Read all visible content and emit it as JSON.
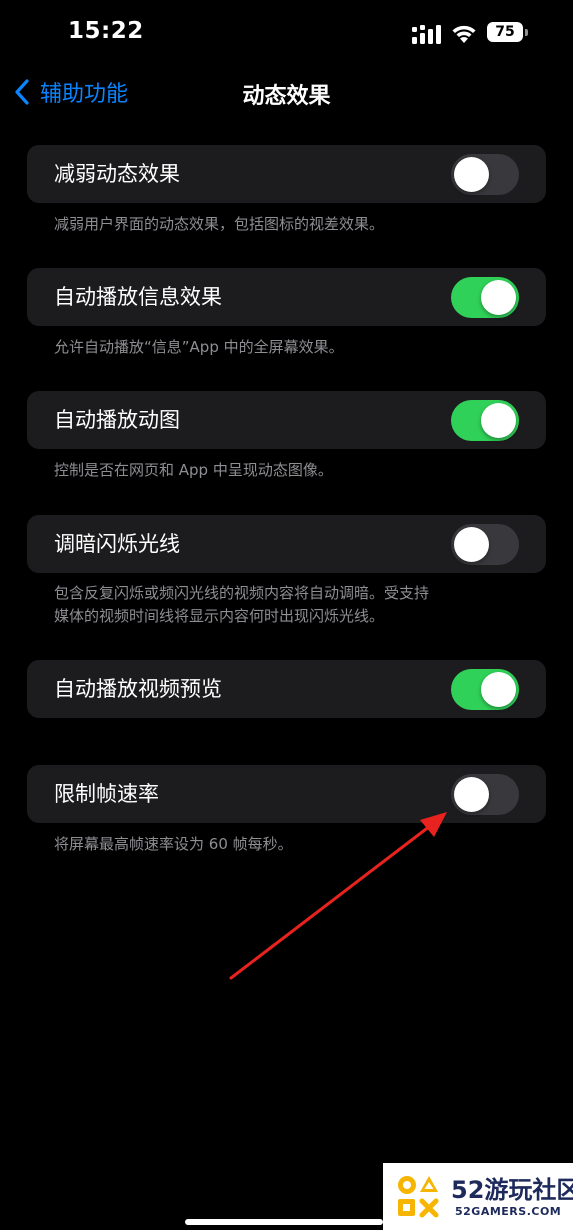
{
  "status_bar": {
    "time": "15:22",
    "battery_percent": "75"
  },
  "nav": {
    "back_label": "辅助功能",
    "title": "动态效果"
  },
  "settings": [
    {
      "label": "减弱动态效果",
      "on": false,
      "footer": "减弱用户界面的动态效果，包括图标的视差效果。"
    },
    {
      "label": "自动播放信息效果",
      "on": true,
      "footer": "允许自动播放“信息”App 中的全屏幕效果。"
    },
    {
      "label": "自动播放动图",
      "on": true,
      "footer": "控制是否在网页和 App 中呈现动态图像。"
    },
    {
      "label": "调暗闪烁光线",
      "on": false,
      "footer_lines": [
        "包含反复闪烁或频闪光线的视频内容将自动调暗。受支持",
        "媒体的视频时间线将显示内容何时出现闪烁光线。"
      ]
    },
    {
      "label": "自动播放视频预览",
      "on": true
    },
    {
      "label": "限制帧速率",
      "on": false,
      "footer": "将屏幕最高帧速率设为 60 帧每秒。"
    }
  ],
  "watermark": {
    "number": "52",
    "title": "游玩社区",
    "subtitle": "52GAMERS.COM"
  },
  "colors": {
    "accent": "#0a84ff",
    "toggle_on": "#30d158",
    "toggle_off": "#39393d",
    "cell_bg": "#1c1c1e",
    "arrow": "#e8231f"
  }
}
